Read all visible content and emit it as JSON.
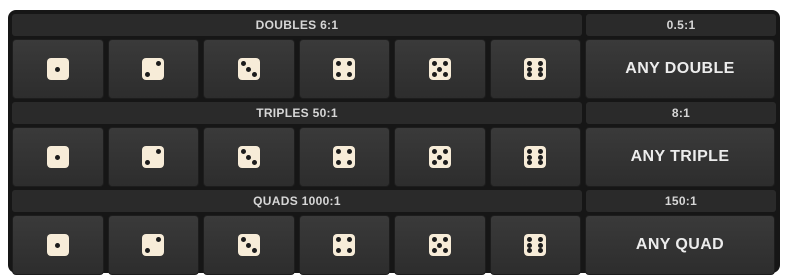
{
  "sections": [
    {
      "id": "doubles",
      "header": "DOUBLES 6:1",
      "any_odds": "0.5:1",
      "any_label": "ANY DOUBLE",
      "dice": [
        1,
        2,
        3,
        4,
        5,
        6
      ]
    },
    {
      "id": "triples",
      "header": "TRIPLES 50:1",
      "any_odds": "8:1",
      "any_label": "ANY TRIPLE",
      "dice": [
        1,
        2,
        3,
        4,
        5,
        6
      ]
    },
    {
      "id": "quads",
      "header": "QUADS 1000:1",
      "any_odds": "150:1",
      "any_label": "ANY QUAD",
      "dice": [
        1,
        2,
        3,
        4,
        5,
        6
      ]
    }
  ],
  "colors": {
    "board": "#161616",
    "cell": "#333333",
    "die_face": "#f7ecd8",
    "pip": "#1c1c1c",
    "text": "#ececec"
  }
}
